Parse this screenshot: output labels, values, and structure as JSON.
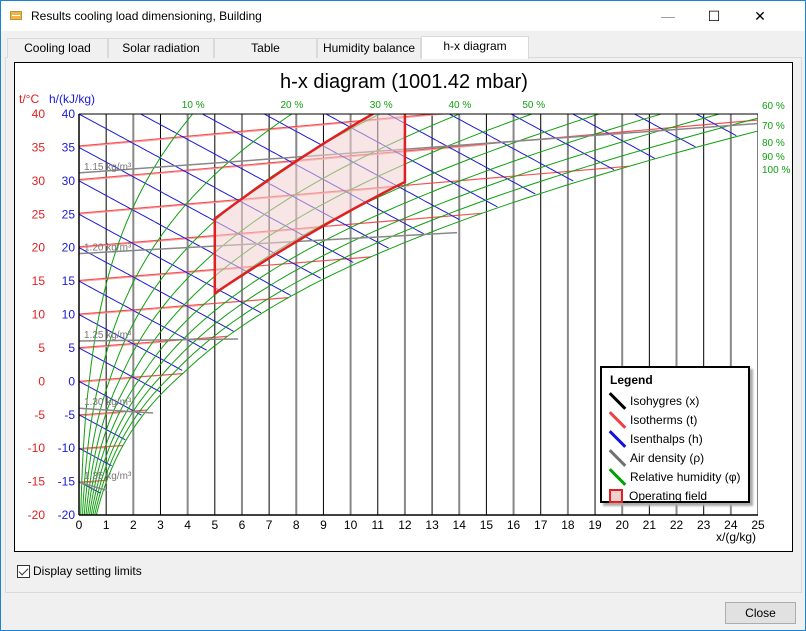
{
  "window": {
    "title": "Results cooling load dimensioning, Building",
    "icon": "table-icon",
    "controls": {
      "minimize": "—",
      "maximize": "☐",
      "close": "✕"
    }
  },
  "tabs": [
    {
      "label": "Cooling load",
      "active": false
    },
    {
      "label": "Solar radiation",
      "active": false
    },
    {
      "label": "Table",
      "active": false
    },
    {
      "label": "Humidity balance",
      "active": false
    },
    {
      "label": "h-x diagram",
      "active": true
    }
  ],
  "checkbox": {
    "label": "Display setting limits",
    "checked": true
  },
  "buttons": {
    "close": "Close"
  },
  "colors": {
    "isohygres": "#000000",
    "isotherms": "#e02020",
    "isenthalps": "#1010d0",
    "air_density": "#808080",
    "relative_humidity": "#00a000",
    "operating_field_fill": "#f2cfcf",
    "operating_field_stroke": "#e02020"
  },
  "chart_data": {
    "type": "line",
    "title": "h-x diagram (1001.42 mbar)",
    "pressure_mbar": 1001.42,
    "xlabel": "x/(g/kg)",
    "ylabel_t": "t/°C",
    "ylabel_h": "h/(kJ/kg)",
    "xlim": [
      0,
      25
    ],
    "ylim": [
      -20,
      40
    ],
    "x_ticks": [
      0,
      1,
      2,
      3,
      4,
      5,
      6,
      7,
      8,
      9,
      10,
      11,
      12,
      13,
      14,
      15,
      16,
      17,
      18,
      19,
      20,
      21,
      22,
      23,
      24,
      25
    ],
    "t_ticks": [
      40,
      35,
      30,
      25,
      20,
      15,
      10,
      5,
      0,
      -5,
      -10,
      -15,
      -20
    ],
    "h_ticks": [
      40,
      35,
      30,
      25,
      20,
      15,
      10,
      5,
      0,
      -5,
      -10,
      -15,
      -20
    ],
    "isotherms_c": [
      -15,
      -10,
      -5,
      0,
      5,
      10,
      15,
      20,
      25,
      30,
      35
    ],
    "isenthalps_kj_kg": [
      -15,
      -10,
      -5,
      0,
      5,
      10,
      15,
      20,
      25,
      30,
      35,
      40,
      45,
      50,
      55,
      60,
      65,
      70,
      75,
      80,
      85,
      90,
      95,
      100,
      105
    ],
    "relative_humidity_percent": [
      10,
      20,
      30,
      40,
      50,
      60,
      70,
      80,
      90,
      100
    ],
    "rh_top_labels": [
      "10 %",
      "20 %",
      "30 %",
      "40 %",
      "50 %"
    ],
    "rh_right_labels": [
      "60 %",
      "70 %",
      "80 %",
      "90 %",
      "100 %"
    ],
    "air_density_lines": [
      {
        "label": "1.15 kg/m³",
        "value": 1.15
      },
      {
        "label": "1.20 kg/m³",
        "value": 1.2
      },
      {
        "label": "1.25 kg/m³",
        "value": 1.25
      },
      {
        "label": "1.30 kg/m³",
        "value": 1.3
      },
      {
        "label": "1.35 kg/m³",
        "value": 1.35
      }
    ],
    "operating_field": {
      "x_min_g_kg": 5,
      "x_max_g_kg": 12,
      "t_min_c": 17,
      "t_max_c": 26,
      "corners": [
        {
          "x": 5,
          "t": 22.5
        },
        {
          "x": 12,
          "t": 38
        },
        {
          "x": 12,
          "t": 25.5
        },
        {
          "x": 5,
          "t": 11.5
        }
      ]
    },
    "legend": {
      "title": "Legend",
      "position": "bottom-right",
      "items": [
        {
          "label": "Isohygres (x)",
          "type": "line",
          "color": "#000000"
        },
        {
          "label": "Isotherms (t)",
          "type": "line",
          "color": "#e02020"
        },
        {
          "label": "Isenthalps (h)",
          "type": "line",
          "color": "#1010d0"
        },
        {
          "label": "Air density (ρ)",
          "type": "line",
          "color": "#808080"
        },
        {
          "label": "Relative humidity (φ)",
          "type": "line",
          "color": "#00a000"
        },
        {
          "label": "Operating field",
          "type": "box",
          "color": "#e02020"
        }
      ]
    }
  }
}
